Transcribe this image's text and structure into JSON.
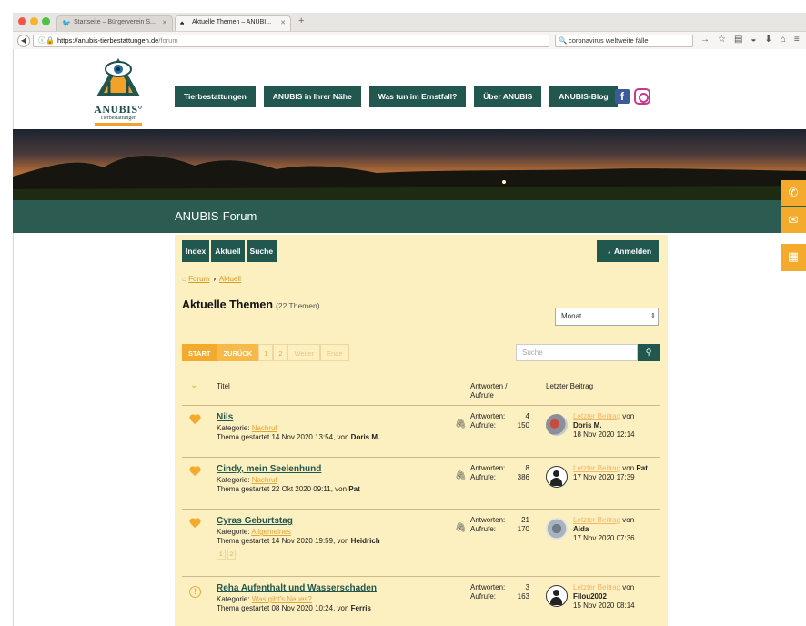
{
  "browser": {
    "tabs": [
      {
        "label": "Startseite – Bürgerverein S..."
      },
      {
        "label": "Aktuelle Themen – ANUBI..."
      }
    ],
    "url_host": "https://anubis-tierbestattungen.de",
    "url_path": "/forum",
    "search_value": "coronavirus weltweite fälle"
  },
  "site": {
    "brand": "ANUBIS",
    "brand_sub": "Tierbestattungen",
    "nav": [
      "Tierbestattungen",
      "ANUBIS in Ihrer Nähe",
      "Was tun im Ernstfall?",
      "Über ANUBIS",
      "ANUBIS-Blog"
    ],
    "page_title": "ANUBIS-Forum"
  },
  "forum": {
    "nav": [
      "Index",
      "Aktuell",
      "Suche"
    ],
    "login": "Anmelden",
    "breadcrumb": {
      "root": "Forum",
      "current": "Aktuell"
    },
    "heading": "Aktuelle Themen",
    "heading_count": "(22 Themen)",
    "filter_value": "Monat",
    "pager": {
      "start": "START",
      "back": "ZURÜCK",
      "p1": "1",
      "p2": "2",
      "next": "Weiter",
      "end": "Ende"
    },
    "search_placeholder": "Suche",
    "columns": {
      "title": "Titel",
      "answers": "Antworten /",
      "answers2": "Aufrufe",
      "last": "Letzter Beitrag"
    },
    "rows": [
      {
        "title": "Nils",
        "cat_label": "Kategorie:",
        "category": "Nachruf",
        "started": "Thema gestartet 14 Nov 2020 13:54, von",
        "author": "Doris M.",
        "answers_label": "Antworten:",
        "answers": "4",
        "views_label": "Aufrufe:",
        "views": "150",
        "last_link": "Letzter Beitrag",
        "last_von": "von",
        "last_user": "Doris M.",
        "last_date": "18 Nov 2020 12:14"
      },
      {
        "title": "Cindy, mein Seelenhund",
        "cat_label": "Kategorie:",
        "category": "Nachruf",
        "started": "Thema gestartet 22 Okt 2020 09:11, von",
        "author": "Pat",
        "answers_label": "Antworten:",
        "answers": "8",
        "views_label": "Aufrufe:",
        "views": "386",
        "last_link": "Letzter Beitrag",
        "last_von": "von",
        "last_user": "Pat",
        "last_date": "17 Nov 2020 17:39"
      },
      {
        "title": "Cyras Geburtstag",
        "cat_label": "Kategorie:",
        "category": "Allgemeines",
        "started": "Thema gestartet 14 Nov 2020 19:59, von",
        "author": "Heidrich",
        "pages": [
          "1",
          "2"
        ],
        "answers_label": "Antworten:",
        "answers": "21",
        "views_label": "Aufrufe:",
        "views": "170",
        "last_link": "Letzter Beitrag",
        "last_von": "von",
        "last_user": "Aida",
        "last_date": "17 Nov 2020 07:36"
      },
      {
        "title": "Reha Aufenthalt und Wasserschaden",
        "cat_label": "Kategorie:",
        "category": "Was gibt's Neues?",
        "started": "Thema gestartet 08 Nov 2020 10:24, von",
        "author": "Ferris",
        "answers_label": "Antworten:",
        "answers": "3",
        "views_label": "Aufrufe:",
        "views": "163",
        "last_link": "Letzter Beitrag",
        "last_von": "von",
        "last_user": "Filou2002",
        "last_date": "15 Nov 2020 08:14"
      }
    ]
  },
  "colors": {
    "primary": "#21574f",
    "accent": "#f4aa2c",
    "forum_bg": "#fdf0c0"
  }
}
